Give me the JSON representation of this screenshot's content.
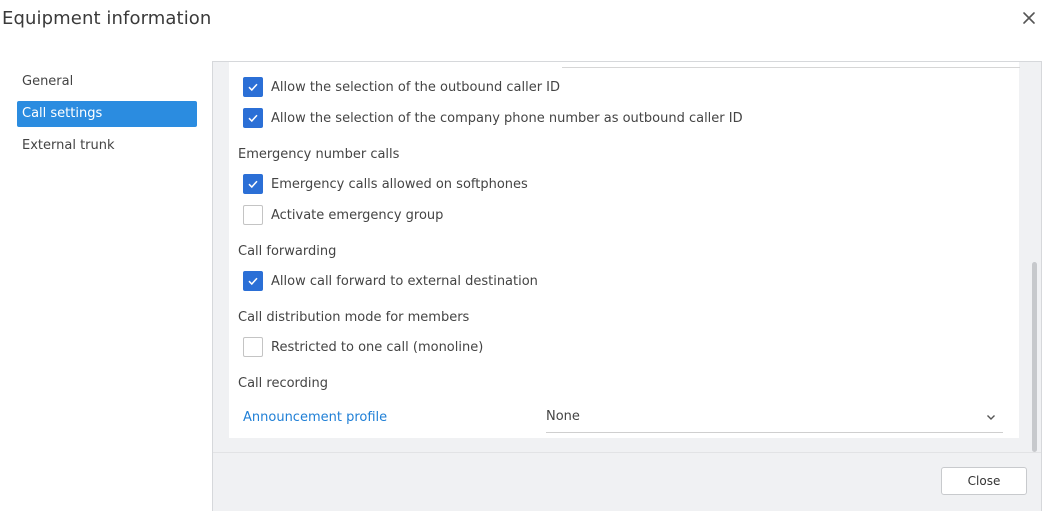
{
  "dialog": {
    "title": "Equipment information",
    "close_icon": "close-icon"
  },
  "nav": {
    "items": [
      {
        "label": "General",
        "active": false
      },
      {
        "label": "Call settings",
        "active": true
      },
      {
        "label": "External trunk",
        "active": false
      }
    ]
  },
  "call_settings": {
    "outbound_caller_id": {
      "label": "Allow the selection of the outbound caller ID",
      "checked": true
    },
    "company_number_caller_id": {
      "label": "Allow the selection of the company phone number as outbound caller ID",
      "checked": true
    },
    "emergency_section": "Emergency number calls",
    "emergency_softphones": {
      "label": "Emergency calls allowed on softphones",
      "checked": true
    },
    "emergency_group": {
      "label": "Activate emergency group",
      "checked": false
    },
    "forwarding_section": "Call forwarding",
    "forward_external": {
      "label": "Allow call forward to external destination",
      "checked": true
    },
    "distribution_section": "Call distribution mode for members",
    "monoline": {
      "label": "Restricted to one call (monoline)",
      "checked": false
    },
    "recording_section": "Call recording",
    "announcement_profile": {
      "label": "Announcement profile",
      "value": "None"
    }
  },
  "footer": {
    "close_label": "Close"
  },
  "colors": {
    "accent": "#2b8ce0",
    "checkbox_checked": "#2b6fd6",
    "link": "#1f7fd6"
  }
}
